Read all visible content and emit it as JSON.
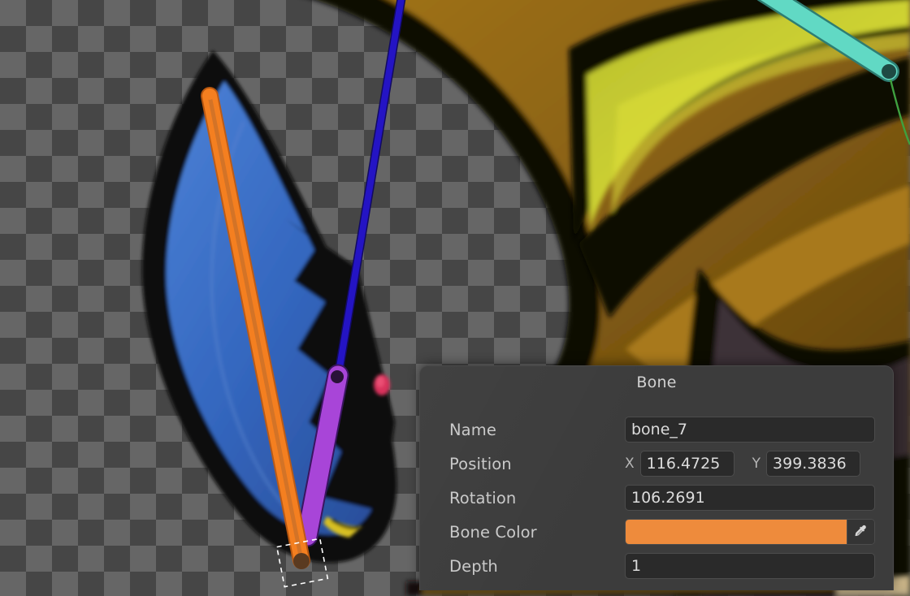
{
  "app": {
    "view": "skeleton-rig-editor",
    "canvas_background": "transparent-checkerboard"
  },
  "panel": {
    "title": "Bone",
    "rows": [
      {
        "label": "Name",
        "type": "text",
        "value": "bone_7"
      },
      {
        "label": "Position",
        "type": "vector2",
        "x_axis": "X",
        "x_value": "116.4725",
        "y_axis": "Y",
        "y_value": "399.3836"
      },
      {
        "label": "Rotation",
        "type": "number",
        "value": "106.2691"
      },
      {
        "label": "Bone Color",
        "type": "color",
        "value": "#ee8b3c",
        "picker_icon": "eyedropper-icon"
      },
      {
        "label": "Depth",
        "type": "number",
        "value": "1"
      }
    ],
    "colors": {
      "background": "#3c3c3c",
      "field_background": "#2a2a2a",
      "field_border": "#4c4c4c",
      "label_text": "#c9c9c9",
      "value_text": "#dcdcdc",
      "title_text": "#d2d2d2"
    }
  },
  "canvas": {
    "checker_light": "#666666",
    "checker_dark": "#464646",
    "bones": [
      {
        "name": "bone-orange-selected",
        "color": "#f47f20",
        "selected": true,
        "joint_color": "#5a3a20"
      },
      {
        "name": "bone-purple",
        "color": "#a845d8",
        "selected": false,
        "joint_color": "#2a1238"
      },
      {
        "name": "bone-darkblue",
        "color": "#2414c4",
        "selected": false,
        "joint_color": "#120a60"
      },
      {
        "name": "bone-teal",
        "color": "#61d9c4",
        "selected": false,
        "joint_color": "#1e4a44"
      },
      {
        "name": "bone-link-green",
        "color": "#3fa03f",
        "selected": false,
        "joint_color": "#1e4a1e"
      }
    ],
    "selection": {
      "style": "dashed-rectangle",
      "color": "#ffffff"
    },
    "artwork": {
      "description": "cartoon-character-sprite",
      "palette": {
        "body_gold": "#9a7018",
        "body_gold_dark": "#6d4d10",
        "highlight_yellow": "#c8cc28",
        "outline_black": "#0a0a05",
        "wing_blue": "#3a6fc8",
        "wing_blue_dark": "#2b54a0",
        "muzzle_dark": "#3d3038",
        "eye_red": "#d8335c",
        "beak_yellow": "#d8c020"
      }
    }
  }
}
